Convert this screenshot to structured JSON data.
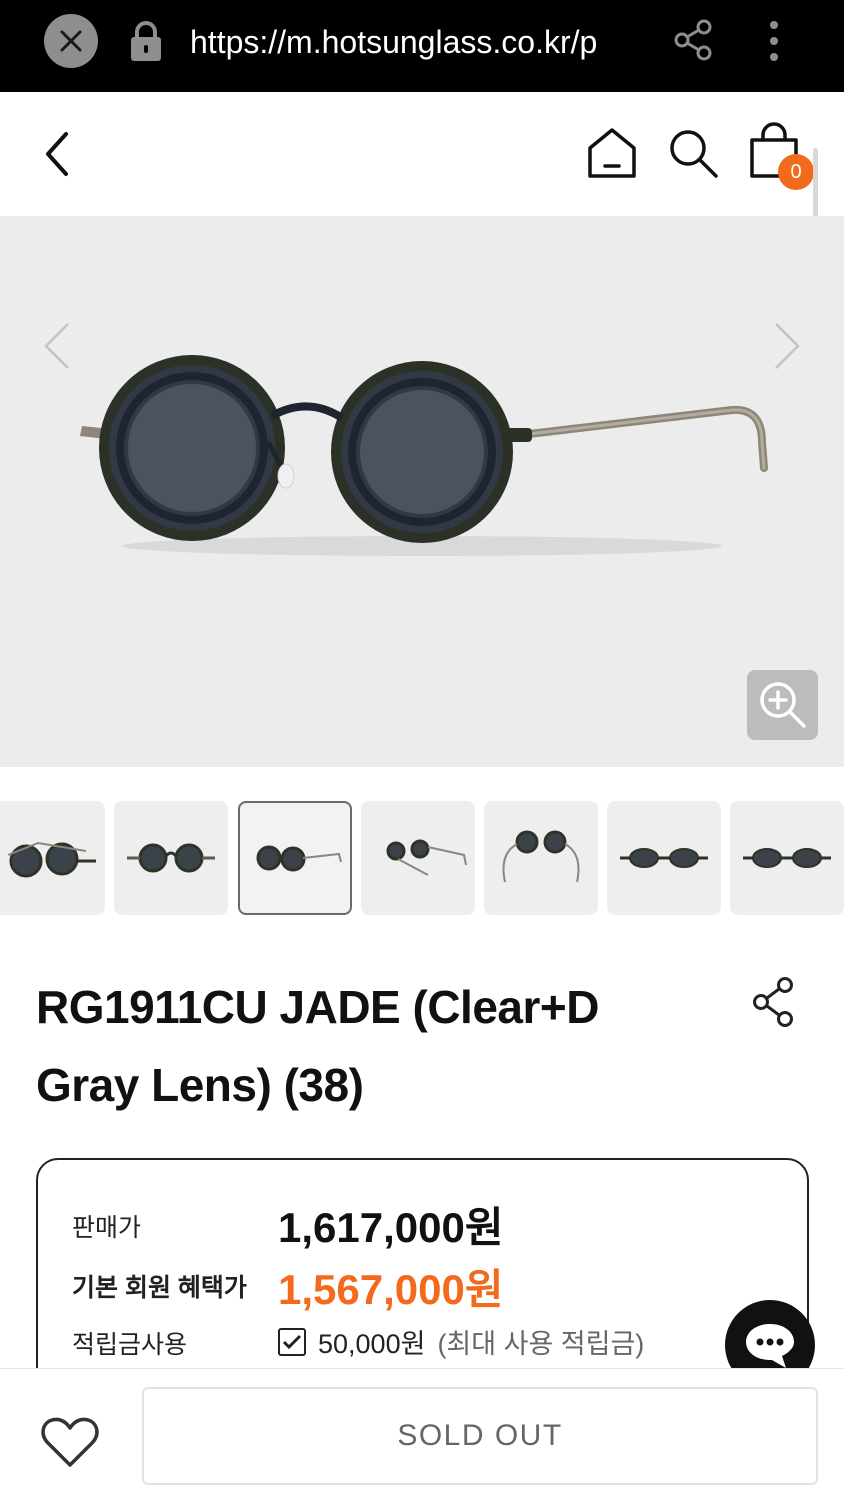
{
  "browser": {
    "url": "https://m.hotsunglass.co.kr/p",
    "icons": [
      "close-icon",
      "lock-icon",
      "share-icon",
      "more-vertical-icon"
    ]
  },
  "header": {
    "icons": [
      "back-icon",
      "home-icon",
      "search-icon",
      "cart-icon"
    ],
    "cart_count": "0",
    "cart_badge_color": "#f26a1b"
  },
  "gallery": {
    "icons": [
      "chevron-left-icon",
      "chevron-right-icon",
      "zoom-in-icon"
    ],
    "thumbnail_count": 7,
    "active_thumbnail": 3
  },
  "product": {
    "title_line1": "RG1911CU JADE (Clear+D",
    "title_line2": "Gray Lens) (38)",
    "share_icon": "share-icon"
  },
  "price": {
    "sale_label": "판매가",
    "sale_value": "1,617,000원",
    "member_label": "기본 회원 혜택가",
    "member_value": "1,567,000원",
    "member_color": "#f26a1b",
    "points_label": "적립금사용",
    "points_checked": true,
    "points_value": "50,000원",
    "points_note": "(최대 사용 적립금)"
  },
  "chat": {
    "icon": "chat-bubble-icon"
  },
  "bottom": {
    "wishlist_icon": "heart-icon",
    "soldout_label": "SOLD OUT"
  }
}
